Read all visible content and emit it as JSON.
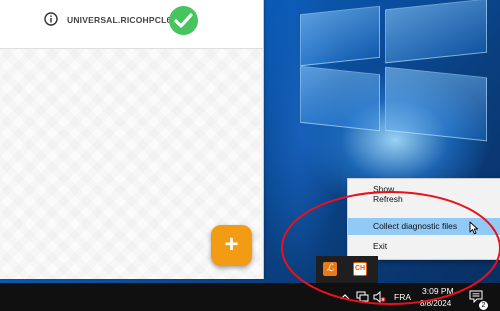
{
  "app": {
    "printer_name": "UNIVERSAL.RICOHPCL6U...",
    "fab_label": "+"
  },
  "context_menu": {
    "items": [
      {
        "label": "Show"
      },
      {
        "label": "Refresh"
      },
      {
        "label": "Collect diagnostic files"
      },
      {
        "label": "Exit"
      }
    ],
    "highlighted": "Collect diagnostic files"
  },
  "tray_flyout": {
    "apps": [
      {
        "icon": "app-orange-script-icon",
        "glyph": "ℒ"
      },
      {
        "icon": "app-white-orange-icon",
        "glyph": "CH"
      }
    ]
  },
  "taskbar": {
    "language": "FRA",
    "time": "3:09 PM",
    "date": "8/8/2024",
    "notification_count": "2",
    "icons": [
      "chevron-up-icon",
      "network-icon",
      "volume-muted-icon",
      "action-center-icon"
    ]
  },
  "colors": {
    "success": "#45c55b",
    "fab": "#f39b12",
    "menu_highlight": "#91c9f7",
    "annotation": "#e8121b"
  }
}
